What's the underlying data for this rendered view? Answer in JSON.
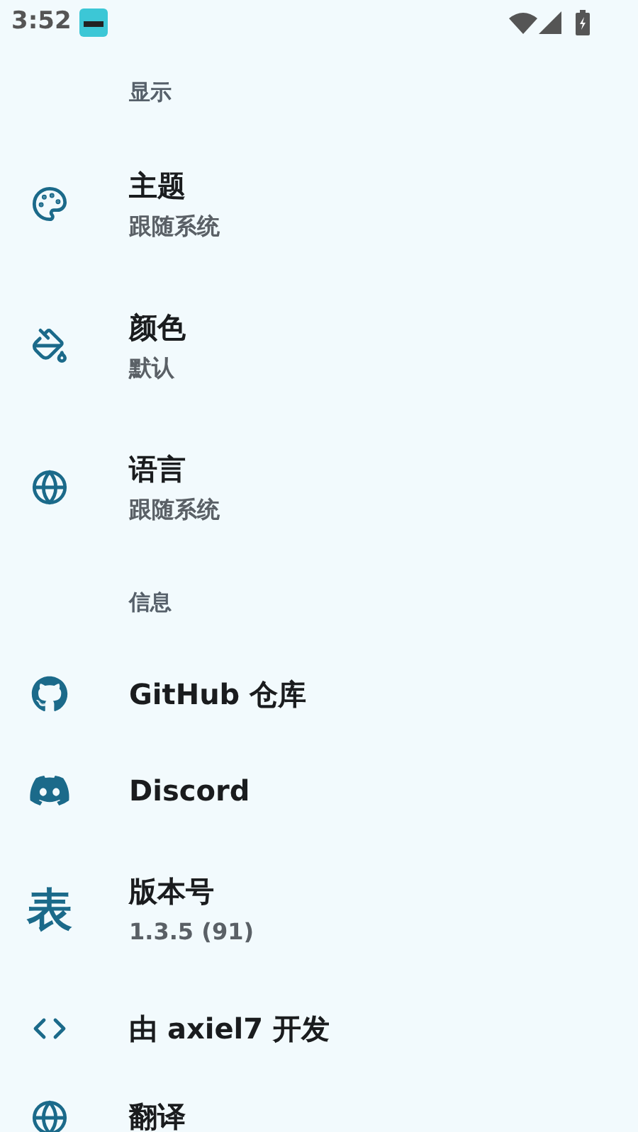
{
  "status_bar": {
    "time": "3:52"
  },
  "sections": [
    {
      "header": "显示",
      "items": [
        {
          "title": "主题",
          "subtitle": "跟随系统"
        },
        {
          "title": "颜色",
          "subtitle": "默认"
        },
        {
          "title": "语言",
          "subtitle": "跟随系统"
        }
      ]
    },
    {
      "header": "信息",
      "items": [
        {
          "title": "GitHub 仓库"
        },
        {
          "title": "Discord"
        },
        {
          "icon_text": "表",
          "title": "版本号",
          "subtitle": "1.3.5 (91)"
        },
        {
          "title": "由 axiel7 开发"
        },
        {
          "title": "翻译"
        }
      ]
    }
  ]
}
